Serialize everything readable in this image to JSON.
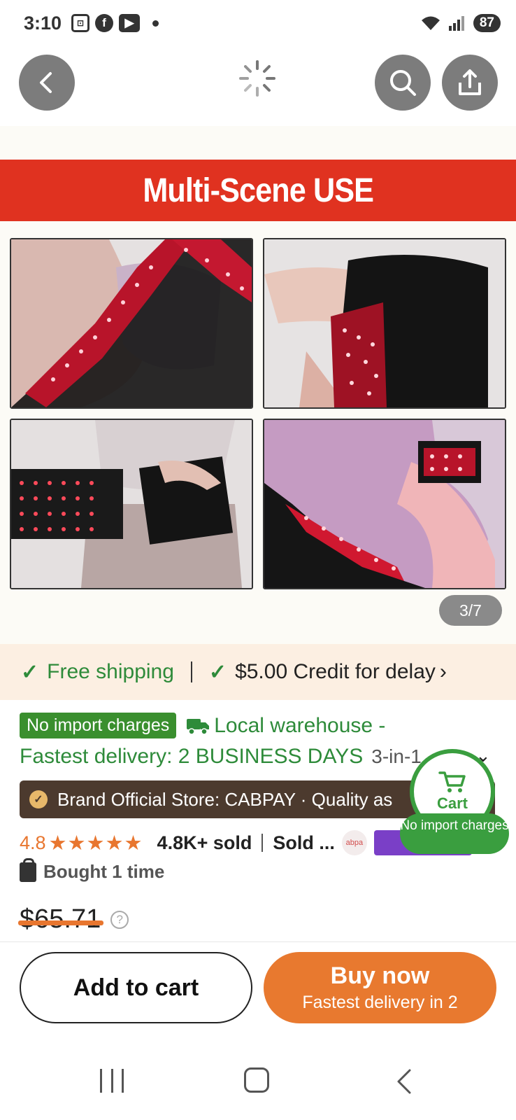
{
  "status_bar": {
    "time": "3:10",
    "battery": "87",
    "icons": [
      "screenshot-icon",
      "facebook-icon",
      "youtube-icon",
      "dot-icon",
      "wifi-icon",
      "signal-icon"
    ]
  },
  "gallery": {
    "banner_text": "Multi-Scene USE",
    "counter": "3/7",
    "colors": {
      "banner": "#e03220",
      "led": "#ff2a3a"
    }
  },
  "shipping": {
    "free_shipping": "Free shipping",
    "credit": "$5.00 Credit for delay"
  },
  "product": {
    "no_import_badge": "No import charges",
    "warehouse": "Local warehouse -",
    "fastest_delivery": "Fastest delivery: 2 BUSINESS DAYS",
    "variant": "3-in-1",
    "brand_store": "Brand Official Store: CABPAY · Quality as",
    "rating": "4.8",
    "stars": "★★★★★",
    "sold_count": "4.8K+ sold",
    "sold_by": "Sold ...",
    "store_logo_text": "abpa",
    "bought": "Bought 1 time",
    "price": "$65.71"
  },
  "floating_cart": {
    "label": "Cart",
    "note": "No import charges"
  },
  "actions": {
    "add_to_cart": "Add to cart",
    "buy_now": "Buy now",
    "buy_now_sub": "Fastest delivery in 2"
  },
  "theme": {
    "accent_orange": "#e8792f",
    "green": "#3a9e3f",
    "brand_bar": "#4c3a2e"
  }
}
